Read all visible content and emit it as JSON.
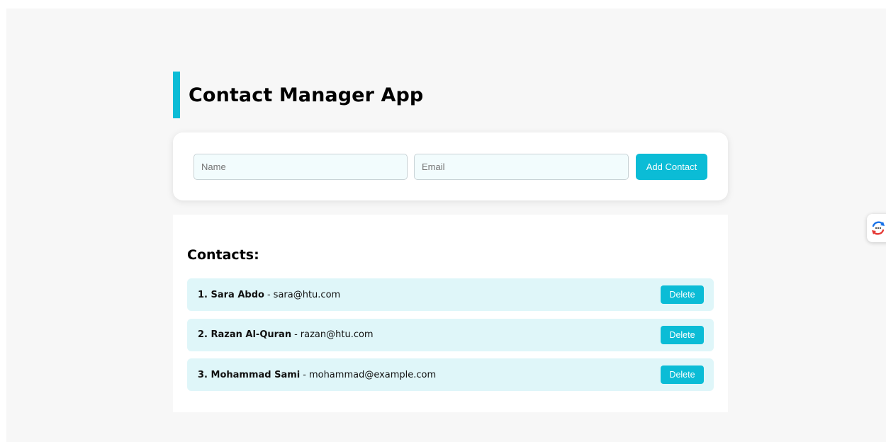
{
  "app": {
    "title": "Contact Manager App"
  },
  "form": {
    "name_placeholder": "Name",
    "name_value": "",
    "email_placeholder": "Email",
    "email_value": "",
    "add_label": "Add Contact"
  },
  "contacts": {
    "heading": "Contacts:",
    "delete_label": "Delete",
    "separator": "-",
    "items": [
      {
        "index": "1.",
        "name": "Sara Abdo",
        "email": "sara@htu.com"
      },
      {
        "index": "2.",
        "name": "Razan Al-Quran",
        "email": "razan@htu.com"
      },
      {
        "index": "3.",
        "name": "Mohammad Sami",
        "email": "mohammad@example.com"
      }
    ]
  },
  "colors": {
    "accent": "#0bbcd6",
    "row_bg": "#dff6f9",
    "page_bg": "#f7f7f7"
  },
  "icons": {
    "extension_widget": "sync-chat-icon"
  }
}
